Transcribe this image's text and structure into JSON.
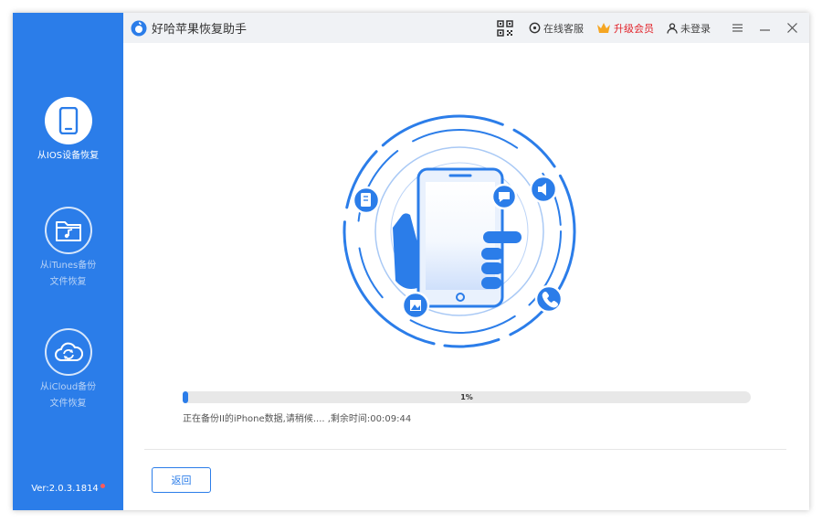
{
  "app": {
    "title": "好哈苹果恢复助手",
    "accent_color": "#2b7de9"
  },
  "titlebar": {
    "qr_icon": "qr-code-icon",
    "support_label": "在线客服",
    "vip_label": "升级会员",
    "login_label": "未登录",
    "menu_icon": "menu-icon",
    "minimize_icon": "minimize-icon",
    "close_icon": "close-icon"
  },
  "sidebar": {
    "items": [
      {
        "label": "从IOS设备恢复",
        "icon": "phone-icon",
        "active": true
      },
      {
        "label_line1": "从iTunes备份",
        "label_line2": "文件恢复",
        "icon": "music-folder-icon",
        "active": false
      },
      {
        "label_line1": "从iCloud备份",
        "label_line2": "文件恢复",
        "icon": "cloud-sync-icon",
        "active": false
      }
    ],
    "version": "Ver:2.0.3.1814"
  },
  "main": {
    "progress": {
      "percent": 1,
      "label": "1%"
    },
    "status_text": "正在备份II的iPhone数据,请稍候.... ,剩余时间:00:09:44",
    "back_label": "返回"
  }
}
